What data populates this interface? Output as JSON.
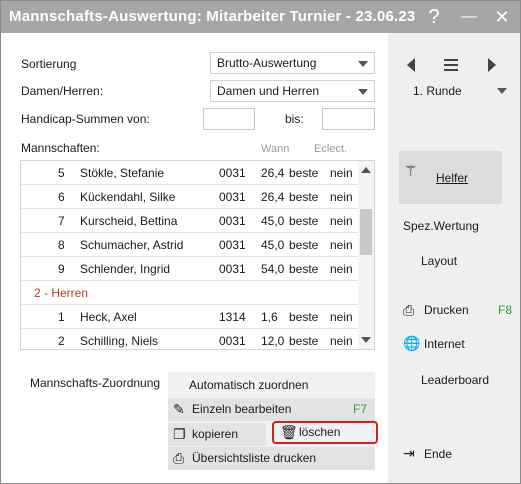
{
  "window": {
    "title": "Mannschafts-Auswertung: Mitarbeiter Turnier - 23.06.23",
    "help_glyph": "?",
    "minimize_glyph": "—",
    "close_glyph": "✕"
  },
  "form": {
    "sortierung_label": "Sortierung",
    "sortierung_value": "Brutto-Auswertung",
    "damenherren_label": "Damen/Herren:",
    "damenherren_value": "Damen und Herren",
    "handicap_label": "Handicap-Summen von:",
    "handicap_from": "",
    "bis_label": "bis:",
    "handicap_to": "",
    "mannschaften_label": "Mannschaften:",
    "col_wann": "Wann",
    "col_eclect": "Eclect."
  },
  "list": {
    "rows": [
      {
        "type": "player",
        "num": "5",
        "name": "Stökle, Stefanie",
        "code": "0031",
        "hcp": "26,4",
        "kind": "beste",
        "eclect": "nein"
      },
      {
        "type": "player",
        "num": "6",
        "name": "Kückendahl, Silke",
        "code": "0031",
        "hcp": "26,4",
        "kind": "beste",
        "eclect": "nein"
      },
      {
        "type": "player",
        "num": "7",
        "name": "Kurscheid, Bettina",
        "code": "0031",
        "hcp": "45,0",
        "kind": "beste",
        "eclect": "nein"
      },
      {
        "type": "player",
        "num": "8",
        "name": "Schumacher, Astrid",
        "code": "0031",
        "hcp": "45,0",
        "kind": "beste",
        "eclect": "nein"
      },
      {
        "type": "player",
        "num": "9",
        "name": "Schlender, Ingrid",
        "code": "0031",
        "hcp": "54,0",
        "kind": "beste",
        "eclect": "nein"
      },
      {
        "type": "group",
        "label": "2 - Herren"
      },
      {
        "type": "player",
        "num": "1",
        "name": "Heck, Axel",
        "code": "1314",
        "hcp": "1,6",
        "kind": "beste",
        "eclect": "nein"
      },
      {
        "type": "player",
        "num": "2",
        "name": "Schilling, Niels",
        "code": "0031",
        "hcp": "12,0",
        "kind": "beste",
        "eclect": "nein"
      }
    ]
  },
  "zuordnung": {
    "label": "Mannschafts-Zuordnung",
    "auto": "Automatisch zuordnen",
    "einzeln": "Einzeln bearbeiten",
    "einzeln_key": "F7",
    "kopieren": "kopieren",
    "loeschen": "löschen",
    "uebersicht": "Übersichtsliste drucken"
  },
  "sidebar": {
    "runde_value": "1. Runde",
    "helfer": "Helfer",
    "spez_wertung": "Spez.Wertung",
    "layout": "Layout",
    "drucken": "Drucken",
    "drucken_key": "F8",
    "internet": "Internet",
    "leaderboard": "Leaderboard",
    "ende": "Ende"
  },
  "colors": {
    "titlebar": "#a6a6a6",
    "group_text": "#c0392b",
    "shortcut_green": "#2e9e3e",
    "highlight_border": "#d62020"
  }
}
